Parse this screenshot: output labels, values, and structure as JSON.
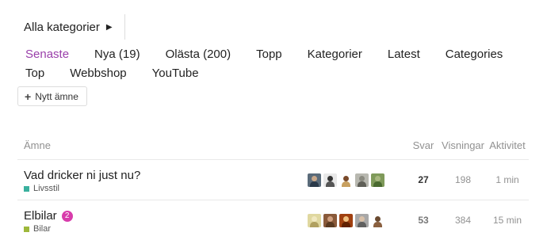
{
  "category_dropdown": {
    "label": "Alla kategorier",
    "caret_icon": "caret-right-icon"
  },
  "nav": {
    "items": [
      {
        "label": "Senaste",
        "active": true
      },
      {
        "label": "Nya (19)"
      },
      {
        "label": "Olästa (200)"
      },
      {
        "label": "Topp"
      },
      {
        "label": "Kategorier"
      },
      {
        "label": "Latest"
      },
      {
        "label": "Categories"
      },
      {
        "label": "Top"
      },
      {
        "label": "Webbshop"
      },
      {
        "label": "YouTube"
      }
    ]
  },
  "new_topic": {
    "label": "Nytt ämne",
    "icon": "plus-icon"
  },
  "table": {
    "headers": {
      "topic": "Ämne",
      "replies": "Svar",
      "views": "Visningar",
      "activity": "Aktivitet"
    },
    "rows": [
      {
        "title": "Vad dricker ni just nu?",
        "category": "Livsstil",
        "category_color": "#3ab09e",
        "unread": "",
        "replies": "27",
        "views": "198",
        "activity": "1 min",
        "posters": [
          {
            "bg": "#5a6b7a",
            "head": "#c9a88a",
            "body": "#2b3a4a"
          },
          {
            "bg": "#e8e8e8",
            "head": "#333333",
            "body": "#555555"
          },
          {
            "bg": "#ffffff",
            "head": "#7a4a2a",
            "body": "#c8a060"
          },
          {
            "bg": "#b8b8b0",
            "head": "#8a8a80",
            "body": "#606058"
          },
          {
            "bg": "#7f9a5a",
            "head": "#a8b880",
            "body": "#4a6a30"
          }
        ]
      },
      {
        "title": "Elbilar",
        "category": "Bilar",
        "category_color": "#9eb83b",
        "unread": "2",
        "replies": "53",
        "views": "384",
        "activity": "15 min",
        "posters": [
          {
            "bg": "#e0d8a0",
            "head": "#f0e8c0",
            "body": "#b0a060"
          },
          {
            "bg": "#8a5a3a",
            "head": "#d0a080",
            "body": "#5a3a20"
          },
          {
            "bg": "#a04010",
            "head": "#f0c080",
            "body": "#602000"
          },
          {
            "bg": "#a8a8a8",
            "head": "#d8c0a8",
            "body": "#606060"
          },
          {
            "bg": "#ffffff",
            "head": "#6a4a30",
            "body": "#8a6040"
          }
        ]
      }
    ]
  }
}
